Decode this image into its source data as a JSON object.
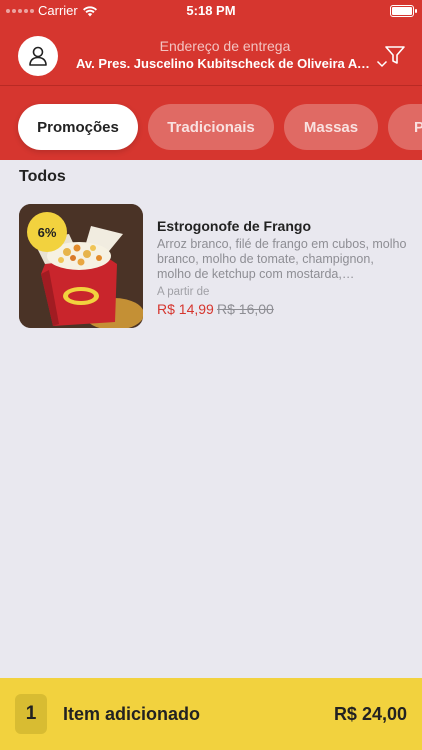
{
  "status_bar": {
    "carrier": "Carrier",
    "time": "5:18 PM"
  },
  "header": {
    "address_label": "Endereço de entrega",
    "address_value": "Av. Pres. Juscelino Kubitscheck de Oliveira Av...",
    "accent_color": "#d6362f"
  },
  "tabs": [
    {
      "label": "Promoções",
      "active": true
    },
    {
      "label": "Tradicionais",
      "active": false
    },
    {
      "label": "Massas",
      "active": false
    },
    {
      "label": "P",
      "active": false
    }
  ],
  "section": {
    "title": "Todos"
  },
  "product": {
    "discount": "6%",
    "name": "Estrogonofe de Frango",
    "description": "Arroz branco, filé de frango em cubos, molho branco, molho de tomate, champignon, molho de ketchup com mostarda, temperos...",
    "from_label": "A partir de",
    "price": "R$ 14,99",
    "old_price": "R$ 16,00"
  },
  "cart": {
    "quantity": "1",
    "label": "Item adicionado",
    "total": "R$ 24,00",
    "color": "#f2d23e"
  }
}
